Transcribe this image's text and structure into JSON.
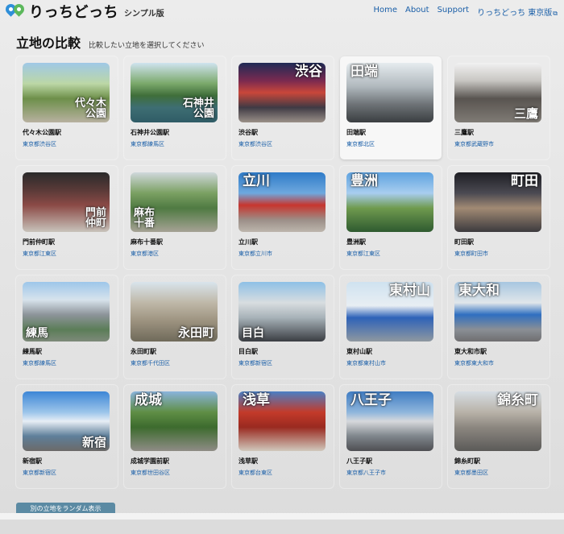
{
  "header": {
    "brand_title": "りっちどっち",
    "brand_sub": "シンプル版",
    "logo_icon": "map-pins-icon",
    "nav": [
      {
        "label": "Home"
      },
      {
        "label": "About"
      },
      {
        "label": "Support"
      },
      {
        "label": "りっちどっち 東京版"
      }
    ]
  },
  "page": {
    "title": "立地の比較",
    "subtitle": "比較したい立地を選択してください"
  },
  "stations": [
    {
      "name": "代々木公園駅",
      "area": "東京都渋谷区",
      "overlay": "代々木\n公園",
      "pos": "br"
    },
    {
      "name": "石神井公園駅",
      "area": "東京都練馬区",
      "overlay": "石神井\n公園",
      "pos": "br"
    },
    {
      "name": "渋谷駅",
      "area": "東京都渋谷区",
      "overlay": "渋谷",
      "pos": "tr"
    },
    {
      "name": "田端駅",
      "area": "東京都北区",
      "overlay": "田端",
      "pos": "tl"
    },
    {
      "name": "三鷹駅",
      "area": "東京都武蔵野市",
      "overlay": "三鷹",
      "pos": "brl"
    },
    {
      "name": "門前仲町駅",
      "area": "東京都江東区",
      "overlay": "門前\n仲町",
      "pos": "br"
    },
    {
      "name": "麻布十番駅",
      "area": "東京都港区",
      "overlay": "麻布\n十番",
      "pos": "bl"
    },
    {
      "name": "立川駅",
      "area": "東京都立川市",
      "overlay": "立川",
      "pos": "tl"
    },
    {
      "name": "豊洲駅",
      "area": "東京都江東区",
      "overlay": "豊洲",
      "pos": "tl"
    },
    {
      "name": "町田駅",
      "area": "東京都町田市",
      "overlay": "町田",
      "pos": "tr"
    },
    {
      "name": "練馬駅",
      "area": "東京都練馬区",
      "overlay": "練馬",
      "pos": "bl"
    },
    {
      "name": "永田町駅",
      "area": "東京都千代田区",
      "overlay": "永田町",
      "pos": "brl"
    },
    {
      "name": "目白駅",
      "area": "東京都新宿区",
      "overlay": "目白",
      "pos": "bl"
    },
    {
      "name": "東村山駅",
      "area": "東京都東村山市",
      "overlay": "東村山",
      "pos": "tr"
    },
    {
      "name": "東大和市駅",
      "area": "東京都東大和市",
      "overlay": "東大和",
      "pos": "tl"
    },
    {
      "name": "新宿駅",
      "area": "東京都新宿区",
      "overlay": "新宿",
      "pos": "brl"
    },
    {
      "name": "成城学園前駅",
      "area": "東京都世田谷区",
      "overlay": "成城",
      "pos": "tl"
    },
    {
      "name": "浅草駅",
      "area": "東京都台東区",
      "overlay": "浅草",
      "pos": "tl"
    },
    {
      "name": "八王子駅",
      "area": "東京都八王子市",
      "overlay": "八王子",
      "pos": "tl"
    },
    {
      "name": "錦糸町駅",
      "area": "東京都墨田区",
      "overlay": "錦糸町",
      "pos": "tr"
    }
  ],
  "selected_index": 3,
  "random_button_label": "別の立地をランダム表示"
}
